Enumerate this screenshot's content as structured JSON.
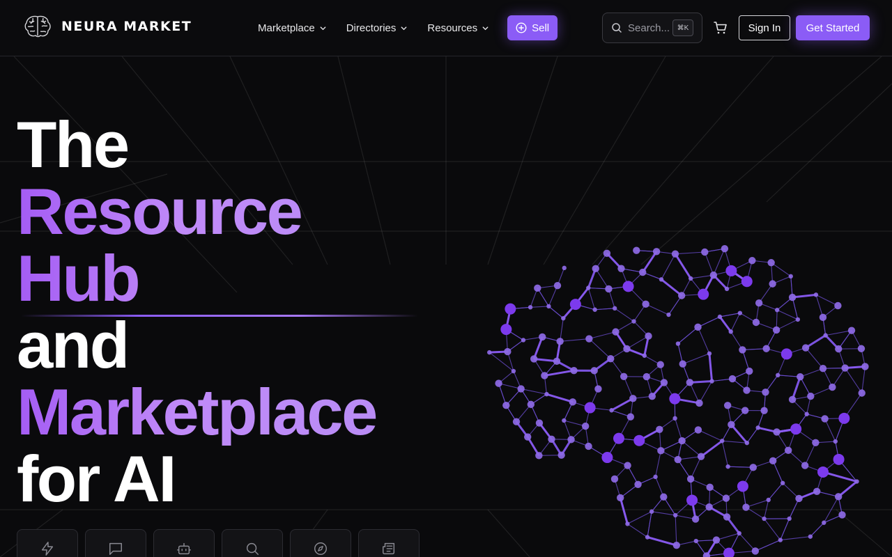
{
  "brand": {
    "name": "NEURA MARKET",
    "logo_icon": "brain-icon",
    "accent": "#8b5cf6",
    "accent_light": "#c08af8",
    "background": "#0a0a0c"
  },
  "nav": {
    "items": [
      {
        "label": "Marketplace",
        "icon": "chevron-down-icon"
      },
      {
        "label": "Directories",
        "icon": "chevron-down-icon"
      },
      {
        "label": "Resources",
        "icon": "chevron-down-icon"
      }
    ],
    "sell_label": "Sell",
    "sell_icon": "plus-circle-icon"
  },
  "search": {
    "placeholder": "Search...",
    "shortcut": "⌘K"
  },
  "header_actions": {
    "cart_icon": "cart-icon",
    "signin_label": "Sign In",
    "get_started_label": "Get Started"
  },
  "hero": {
    "line1": "The",
    "line2": "Resource",
    "line3": "Hub",
    "line4": "and",
    "line5": "Marketplace",
    "line6": "for AI"
  },
  "features": [
    {
      "icon": "lightning-icon"
    },
    {
      "icon": "chat-icon"
    },
    {
      "icon": "robot-icon"
    },
    {
      "icon": "search-icon"
    },
    {
      "icon": "compass-icon"
    },
    {
      "icon": "newspaper-icon"
    }
  ]
}
